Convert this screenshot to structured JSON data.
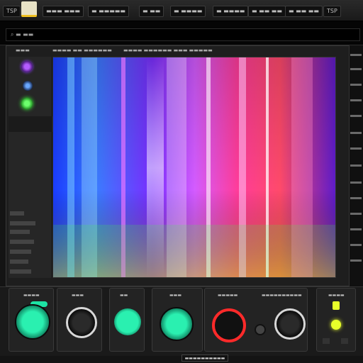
{
  "menubar": {
    "items": [
      "TSP",
      "▬▬▬ ▬▬▬",
      "▬ ▬▬▬▬▬",
      "▬ ▬▬",
      "▬ ▬▬▬▬",
      "▬ ▬▬▬▬",
      "▬ ▬▬ ▬▬"
    ]
  },
  "search": {
    "value": "⌕ ▬ ▬▬"
  },
  "toolbar": {
    "labels": [
      "▬▬▬",
      "▬▬▬▬ ▬▬ ▬▬▬▬▬▬",
      "▬▬▬▬ ▬▬▬▬▬▬ ▬▬▬ ▬▬▬▬▬"
    ]
  },
  "modules": {
    "labels": [
      "▬▬▬▬",
      "▬▬▬",
      "▬▬",
      "▬▬▬",
      "▬▬▬▬▬",
      "▬▬▬▬▬▬▬▬▬▬",
      "▬▬▬▬"
    ]
  },
  "status": {
    "label": "▬▬▬▬▬▬▬▬▬▬"
  },
  "colors": {
    "accent_cyan": "#1de3a4",
    "accent_red": "#ff2a2a",
    "accent_yellow": "#e8ff2a",
    "led_green": "#3cff3c",
    "led_purple": "#8a3cff"
  },
  "icons": [
    "search-icon",
    "power-icon",
    "knob-icon"
  ]
}
